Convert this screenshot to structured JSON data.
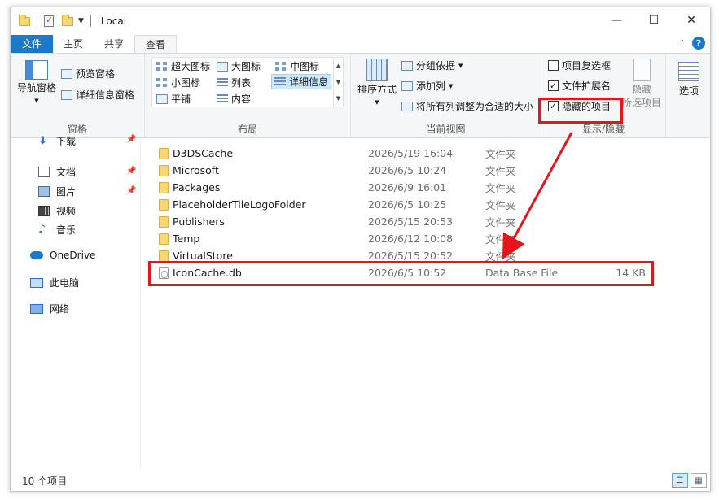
{
  "window": {
    "title": "Local"
  },
  "window_buttons": {
    "minimize": "—",
    "maximize": "☐",
    "close": "✕"
  },
  "tabs": [
    {
      "label": "文件"
    },
    {
      "label": "主页"
    },
    {
      "label": "共享"
    },
    {
      "label": "查看"
    }
  ],
  "ribbon": {
    "panes": {
      "nav_pane": "导航窗格",
      "preview_pane": "预览窗格",
      "details_pane": "详细信息窗格",
      "label": "窗格"
    },
    "layout": {
      "items": [
        "超大图标",
        "大图标",
        "中图标",
        "小图标",
        "列表",
        "详细信息",
        "平铺",
        "内容"
      ],
      "selected": "详细信息",
      "label": "布局"
    },
    "current_view": {
      "sort_by": "排序方式",
      "group_by": "分组依据",
      "add_column": "添加列",
      "fit_columns": "将所有列调整为合适的大小",
      "label": "当前视图"
    },
    "show_hide": {
      "item_checkboxes": {
        "label": "项目复选框",
        "checked": false
      },
      "file_extensions": {
        "label": "文件扩展名",
        "checked": true
      },
      "hidden_items": {
        "label": "隐藏的项目",
        "checked": true
      },
      "hide_selected_line1": "隐藏",
      "hide_selected_line2": "所选项目",
      "label": "显示/隐藏"
    },
    "options": "选项"
  },
  "nav": {
    "items": [
      {
        "label": "下载",
        "icon": "download-icon"
      },
      {
        "label": "文档",
        "icon": "document-icon"
      },
      {
        "label": "图片",
        "icon": "picture-icon"
      },
      {
        "label": "视频",
        "icon": "video-icon"
      },
      {
        "label": "音乐",
        "icon": "music-icon"
      },
      {
        "label": "OneDrive",
        "icon": "onedrive-icon"
      },
      {
        "label": "此电脑",
        "icon": "this-pc-icon"
      },
      {
        "label": "网络",
        "icon": "network-icon"
      }
    ]
  },
  "files": [
    {
      "name": "D3DSCache",
      "date": "2026/5/19 16:04",
      "type": "文件夹",
      "size": ""
    },
    {
      "name": "Microsoft",
      "date": "2026/6/5 10:24",
      "type": "文件夹",
      "size": ""
    },
    {
      "name": "Packages",
      "date": "2026/6/9 16:01",
      "type": "文件夹",
      "size": ""
    },
    {
      "name": "PlaceholderTileLogoFolder",
      "date": "2026/6/5 10:25",
      "type": "文件夹",
      "size": ""
    },
    {
      "name": "Publishers",
      "date": "2026/5/15 20:53",
      "type": "文件夹",
      "size": ""
    },
    {
      "name": "Temp",
      "date": "2026/6/12 10:08",
      "type": "文件夹",
      "size": ""
    },
    {
      "name": "VirtualStore",
      "date": "2026/5/15 20:52",
      "type": "文件夹",
      "size": ""
    },
    {
      "name": "IconCache.db",
      "date": "2026/6/5 10:52",
      "type": "Data Base File",
      "size": "14 KB"
    }
  ],
  "status": {
    "item_count": "10 个项目"
  },
  "colors": {
    "accent": "#1979ca",
    "annotation": "#e8141b",
    "selection": "#cce8ff"
  }
}
